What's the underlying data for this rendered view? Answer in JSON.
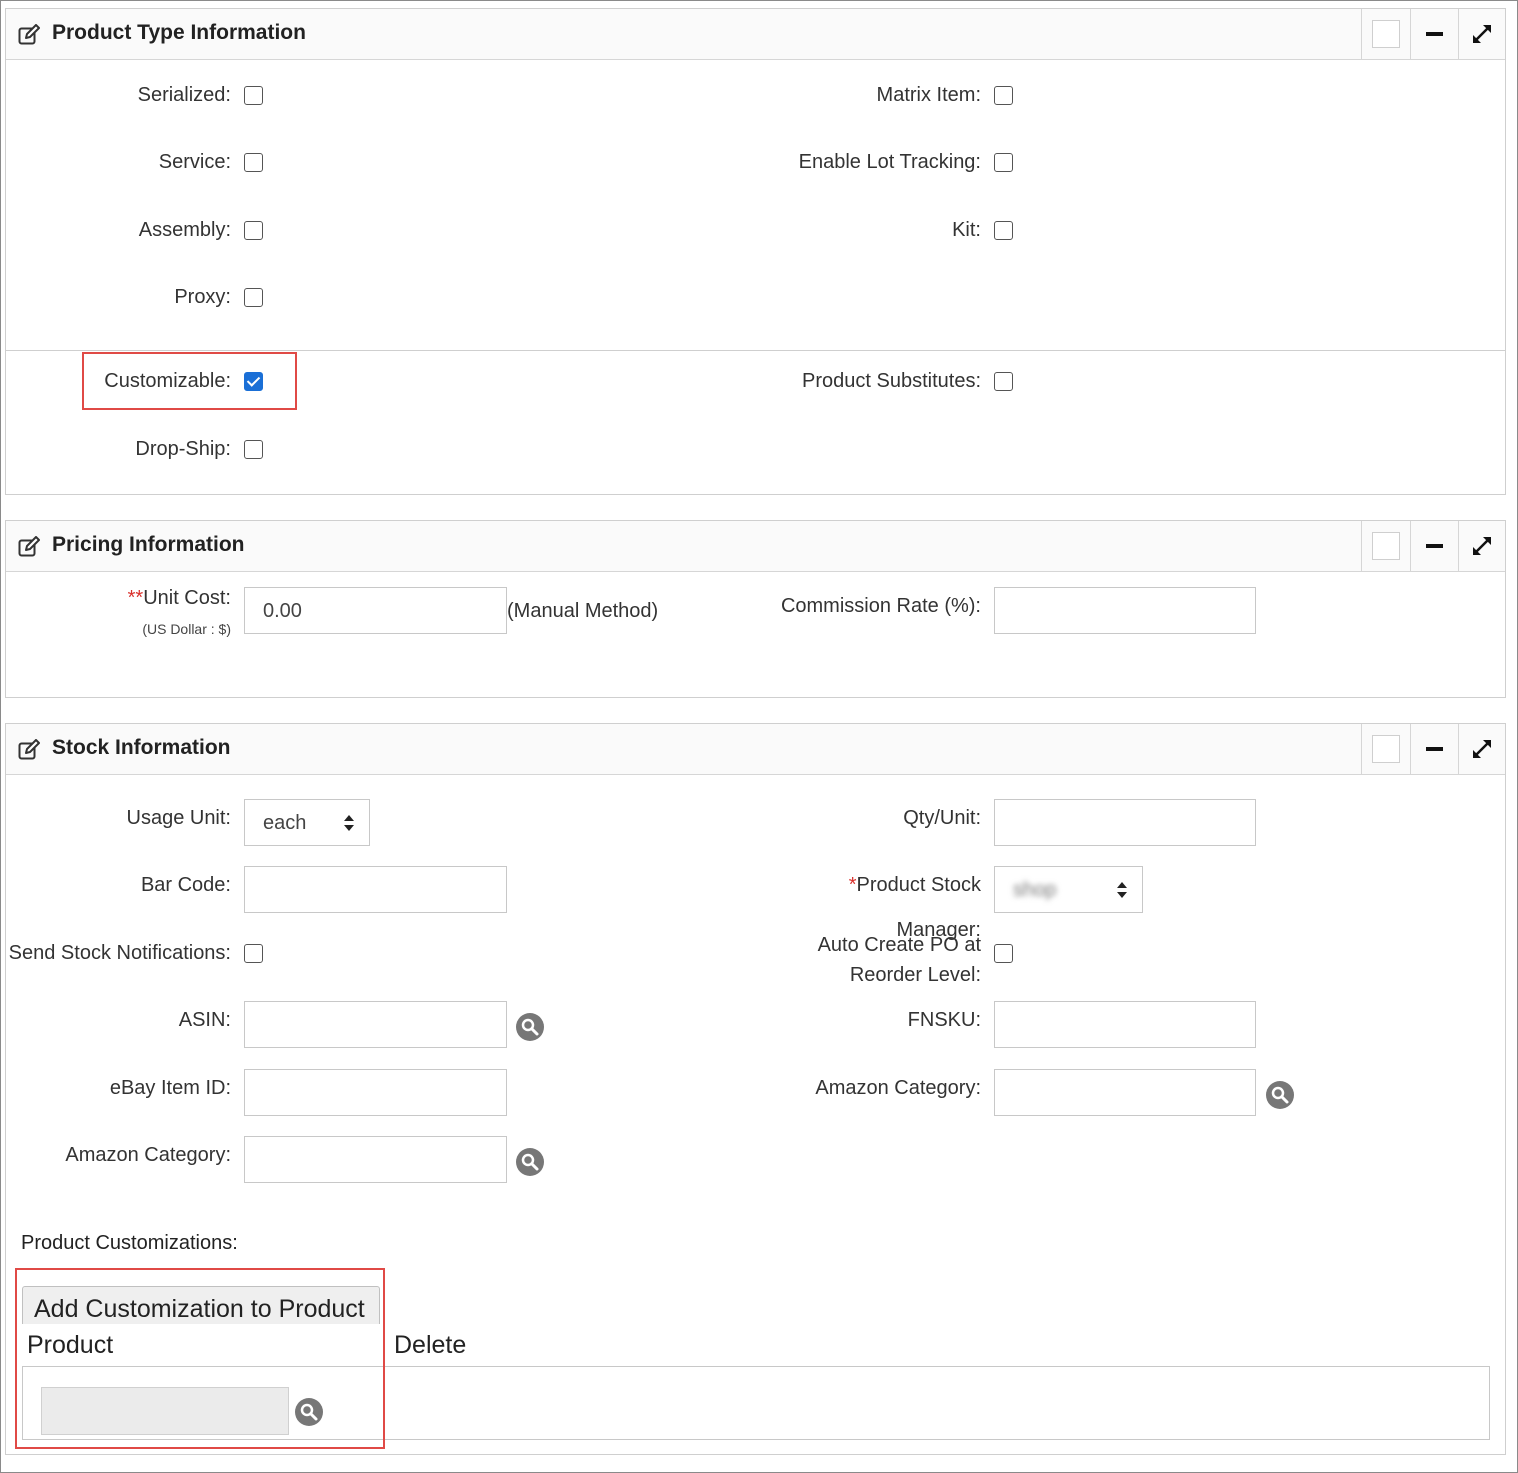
{
  "product_type": {
    "title": "Product Type Information",
    "serialized_label": "Serialized:",
    "matrix_item_label": "Matrix Item:",
    "service_label": "Service:",
    "lot_tracking_label": "Enable Lot Tracking:",
    "assembly_label": "Assembly:",
    "kit_label": "Kit:",
    "proxy_label": "Proxy:",
    "customizable_label": "Customizable:",
    "customizable_checked": true,
    "product_substitutes_label": "Product Substitutes:",
    "drop_ship_label": "Drop-Ship:"
  },
  "pricing": {
    "title": "Pricing Information",
    "unit_cost_required": "**",
    "unit_cost_label": "Unit Cost:",
    "unit_cost_currency": "(US Dollar : $)",
    "unit_cost_value": "0.00",
    "unit_cost_method": "(Manual Method)",
    "commission_label": "Commission Rate (%):",
    "commission_value": ""
  },
  "stock": {
    "title": "Stock Information",
    "usage_unit_label": "Usage Unit:",
    "usage_unit_value": "each",
    "qty_unit_label": "Qty/Unit:",
    "qty_unit_value": "",
    "bar_code_label": "Bar Code:",
    "bar_code_value": "",
    "stock_manager_required": "*",
    "stock_manager_label_line1": "Product Stock",
    "stock_manager_label_line2": "Manager:",
    "stock_manager_value": "shop",
    "send_notifications_label": "Send Stock Notifications:",
    "auto_po_label_line1": "Auto Create PO at",
    "auto_po_label_line2": "Reorder Level:",
    "asin_label": "ASIN:",
    "asin_value": "",
    "fnsku_label": "FNSKU:",
    "fnsku_value": "",
    "ebay_label": "eBay Item ID:",
    "ebay_value": "",
    "amazon_category_right_label": "Amazon Category:",
    "amazon_category_left_label": "Amazon Category:",
    "customizations_label": "Product Customizations:",
    "add_customization_button": "Add Customization to Product",
    "col_product": "Product",
    "col_delete": "Delete"
  },
  "colors": {
    "highlight": "#e04a46",
    "checkbox_checked": "#1a6fd6",
    "required": "#d9302c"
  }
}
